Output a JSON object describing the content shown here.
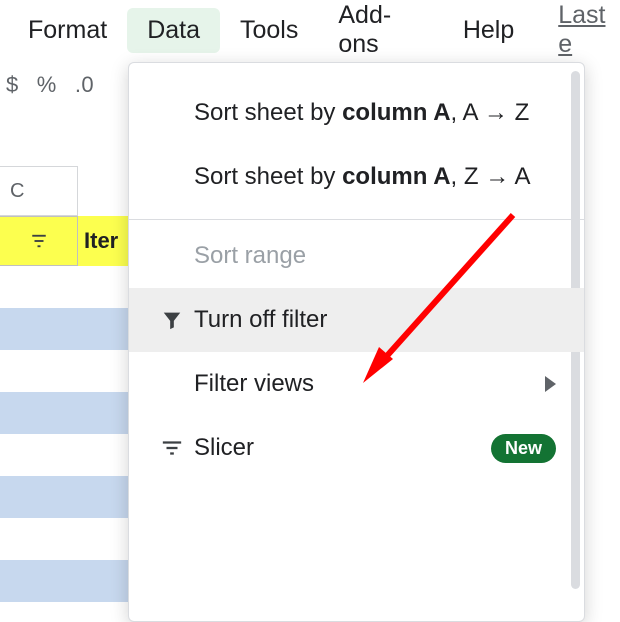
{
  "menubar": {
    "items": [
      "Format",
      "Data",
      "Tools",
      "Add-ons",
      "Help"
    ],
    "active_index": 1,
    "last_edit_label": "Last e"
  },
  "toolbar": {
    "currency": "$",
    "percent": "%",
    "decimal_0": ".0"
  },
  "grid": {
    "col_header": "C",
    "row_label": "Iter"
  },
  "dropdown": {
    "sort_az_prefix": "Sort sheet by ",
    "sort_az_bold": "column A",
    "sort_az_suffix": ", A → Z",
    "sort_za_prefix": "Sort sheet by ",
    "sort_za_bold": "column A",
    "sort_za_suffix": ", Z → A",
    "sort_range": "Sort range",
    "turn_off_filter": "Turn off filter",
    "filter_views": "Filter views",
    "slicer": "Slicer",
    "new_badge": "New"
  }
}
